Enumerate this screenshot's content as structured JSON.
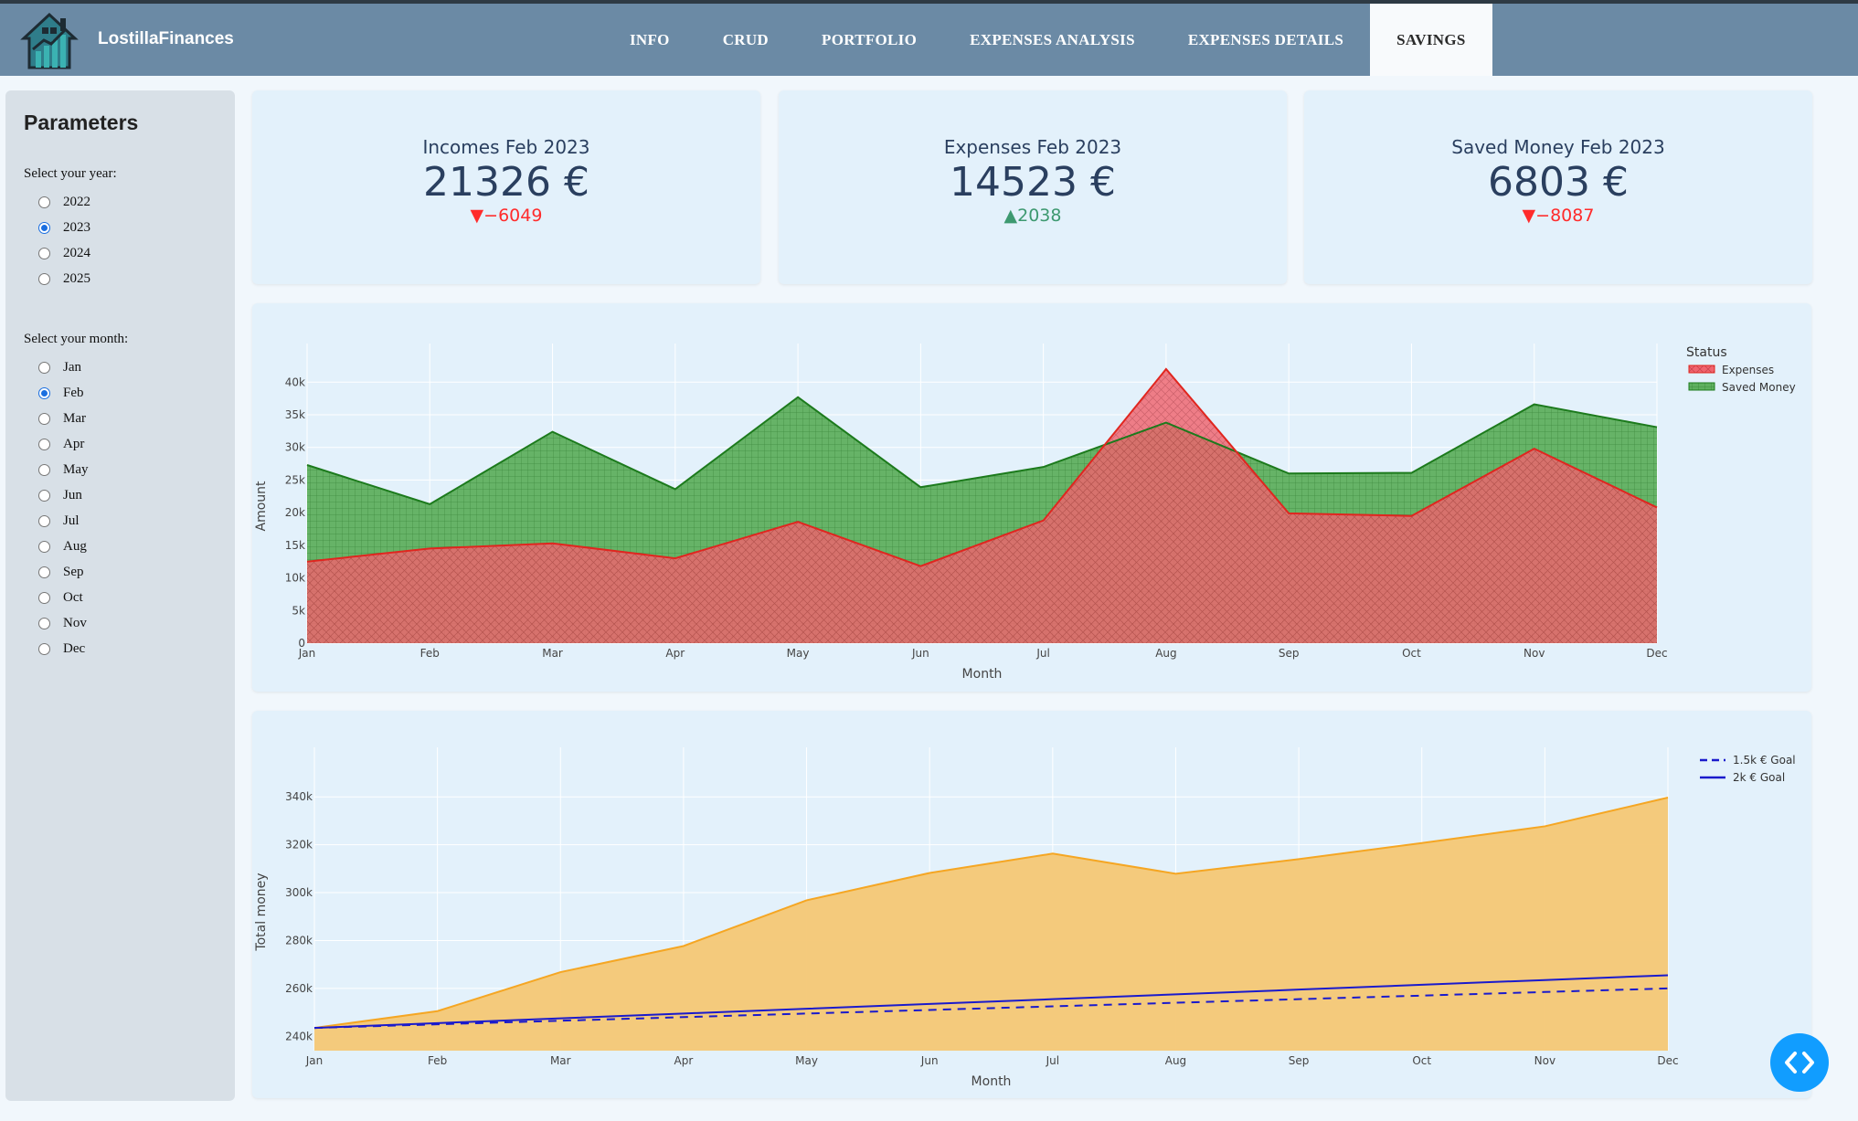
{
  "app": {
    "brand": "LostillaFinances"
  },
  "nav": {
    "tabs": [
      {
        "label": "INFO",
        "active": false
      },
      {
        "label": "CRUD",
        "active": false
      },
      {
        "label": "PORTFOLIO",
        "active": false
      },
      {
        "label": "EXPENSES ANALYSIS",
        "active": false
      },
      {
        "label": "EXPENSES DETAILS",
        "active": false
      },
      {
        "label": "SAVINGS",
        "active": true
      }
    ]
  },
  "sidebar": {
    "title": "Parameters",
    "year_label": "Select your year:",
    "years": [
      {
        "label": "2022",
        "checked": false
      },
      {
        "label": "2023",
        "checked": true
      },
      {
        "label": "2024",
        "checked": false
      },
      {
        "label": "2025",
        "checked": false
      }
    ],
    "month_label": "Select your month:",
    "months": [
      {
        "label": "Jan",
        "checked": false
      },
      {
        "label": "Feb",
        "checked": true
      },
      {
        "label": "Mar",
        "checked": false
      },
      {
        "label": "Apr",
        "checked": false
      },
      {
        "label": "May",
        "checked": false
      },
      {
        "label": "Jun",
        "checked": false
      },
      {
        "label": "Jul",
        "checked": false
      },
      {
        "label": "Aug",
        "checked": false
      },
      {
        "label": "Sep",
        "checked": false
      },
      {
        "label": "Oct",
        "checked": false
      },
      {
        "label": "Nov",
        "checked": false
      },
      {
        "label": "Dec",
        "checked": false
      }
    ]
  },
  "kpis": [
    {
      "title": "Incomes Feb 2023",
      "value": "21326 €",
      "delta": "▼−6049",
      "direction": "down"
    },
    {
      "title": "Expenses Feb 2023",
      "value": "14523 €",
      "delta": "▲2038",
      "direction": "up"
    },
    {
      "title": "Saved Money Feb 2023",
      "value": "6803 €",
      "delta": "▼−8087",
      "direction": "down"
    }
  ],
  "colors": {
    "expenses": "#f0646e",
    "expenses_line": "#e0261f",
    "saved": "#5fb05f",
    "saved_line": "#1c7a1c",
    "total_fill": "#f4c775",
    "total_line": "#f5a623",
    "goal": "#1a1acc",
    "fab": "#119dff"
  },
  "icons": {
    "fab": "code-icon",
    "logo": "house-chart-icon"
  },
  "chart_data": [
    {
      "type": "area",
      "stacked": false,
      "categories": [
        "Jan",
        "Feb",
        "Mar",
        "Apr",
        "May",
        "Jun",
        "Jul",
        "Aug",
        "Sep",
        "Oct",
        "Nov",
        "Dec"
      ],
      "series": [
        {
          "name": "Expenses",
          "values": [
            12500,
            14500,
            15300,
            13000,
            18600,
            11800,
            18800,
            42000,
            19900,
            19500,
            29800,
            20800
          ]
        },
        {
          "name": "Saved Money",
          "values": [
            27300,
            21300,
            32400,
            23600,
            37700,
            23900,
            27000,
            33800,
            26000,
            26100,
            36600,
            33100
          ]
        }
      ],
      "xlabel": "Month",
      "ylabel": "Amount",
      "ylim": [
        0,
        42000
      ],
      "yticks": [
        0,
        5000,
        10000,
        15000,
        20000,
        25000,
        30000,
        35000,
        40000
      ],
      "ytick_labels": [
        "0",
        "5k",
        "10k",
        "15k",
        "20k",
        "25k",
        "30k",
        "35k",
        "40k"
      ],
      "legend_title": "Status",
      "legend_position": "top-right",
      "grid": true
    },
    {
      "type": "area",
      "categories": [
        "Jan",
        "Feb",
        "Mar",
        "Apr",
        "May",
        "Jun",
        "Jul",
        "Aug",
        "Sep",
        "Oct",
        "Nov",
        "Dec"
      ],
      "series": [
        {
          "name": "",
          "values": [
            243500,
            250500,
            266800,
            277700,
            296800,
            308200,
            316300,
            307900,
            314000,
            320700,
            327700,
            339700
          ]
        },
        {
          "name": "1.5k € Goal",
          "dash": true,
          "values": [
            243500,
            245000,
            246500,
            248000,
            249500,
            251000,
            252500,
            254000,
            255500,
            257000,
            258500,
            260000
          ]
        },
        {
          "name": "2k € Goal",
          "dash": false,
          "values": [
            243500,
            245500,
            247500,
            249500,
            251500,
            253500,
            255500,
            257500,
            259500,
            261500,
            263500,
            265500
          ]
        }
      ],
      "xlabel": "Month",
      "ylabel": "Total money",
      "ylim": [
        234000,
        350000
      ],
      "yticks": [
        240000,
        260000,
        280000,
        300000,
        320000,
        340000
      ],
      "ytick_labels": [
        "240k",
        "260k",
        "280k",
        "300k",
        "320k",
        "340k"
      ],
      "legend_position": "top-right",
      "grid": true
    }
  ]
}
